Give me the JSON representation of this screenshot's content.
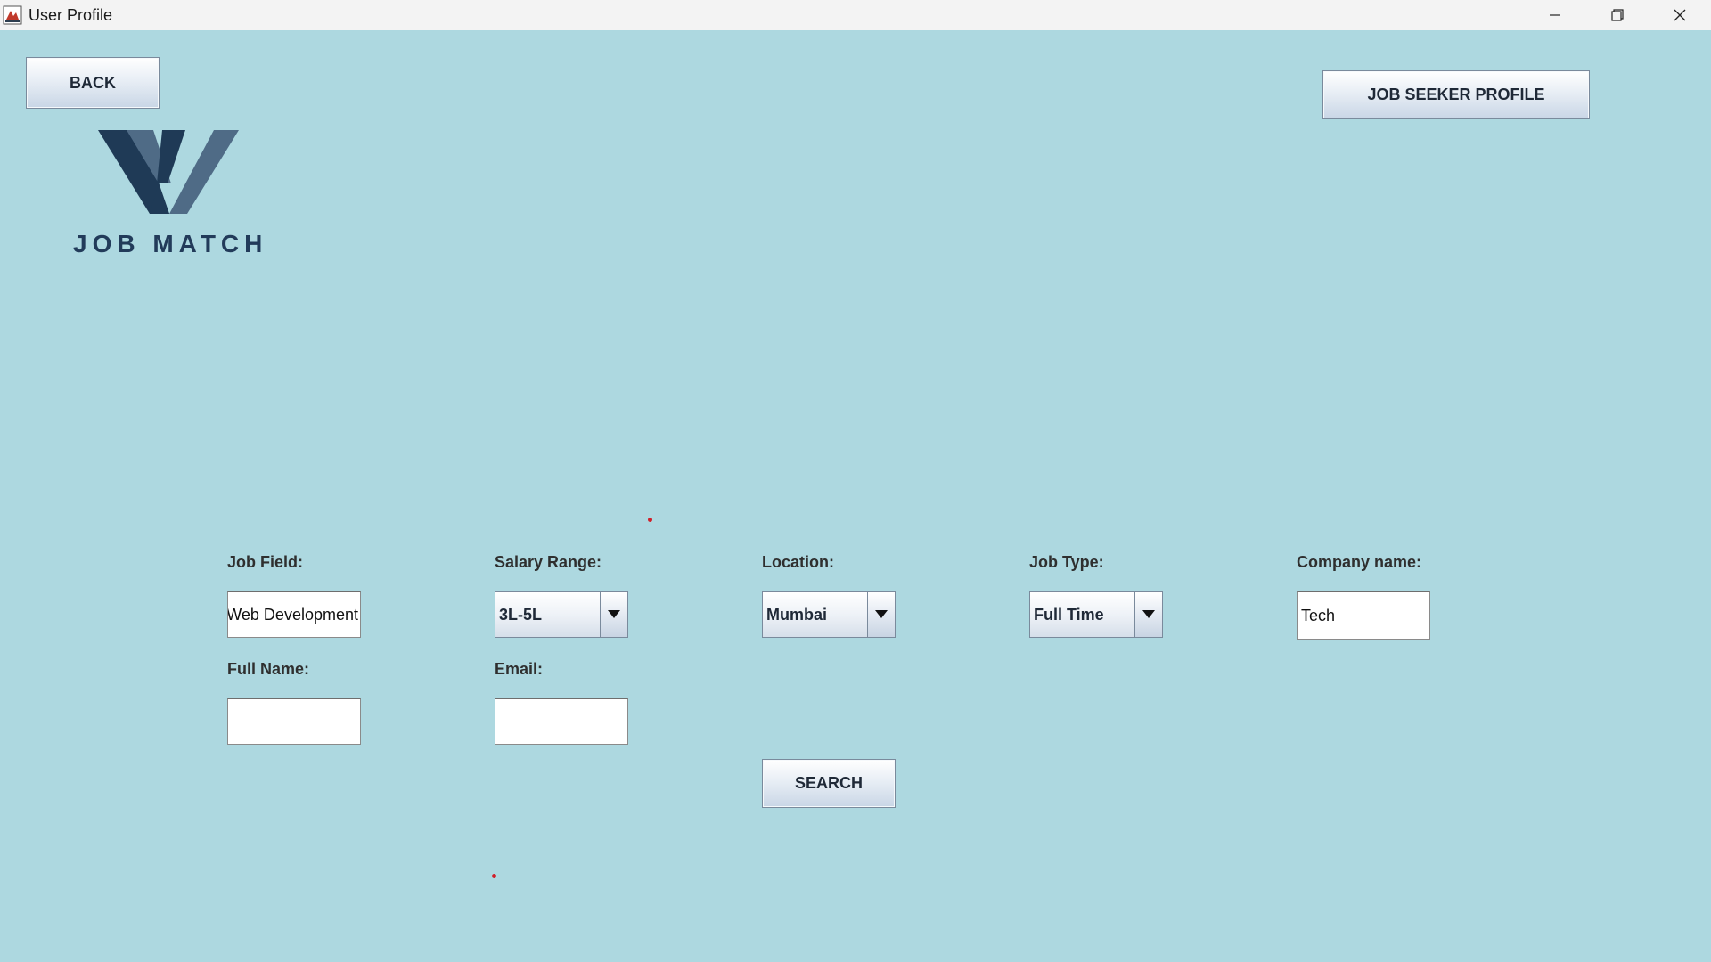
{
  "window": {
    "title": "User Profile"
  },
  "header": {
    "back_label": "BACK",
    "profile_label": "JOB SEEKER PROFILE"
  },
  "logo": {
    "text": "JOB MATCH"
  },
  "form": {
    "job_field": {
      "label": "Job Field:",
      "value": "Web Development"
    },
    "salary_range": {
      "label": "Salary Range:",
      "value": "3L-5L"
    },
    "location": {
      "label": "Location:",
      "value": "Mumbai"
    },
    "job_type": {
      "label": "Job Type:",
      "value": "Full Time"
    },
    "company_name": {
      "label": "Company name:",
      "value": "Tech"
    },
    "full_name": {
      "label": "Full Name:",
      "value": ""
    },
    "email": {
      "label": "Email:",
      "value": ""
    },
    "search_label": "SEARCH"
  },
  "colors": {
    "background": "#add8e0",
    "logo_dark": "#1f3a56",
    "logo_light": "#4f6b86",
    "marker": "#d0202a"
  }
}
